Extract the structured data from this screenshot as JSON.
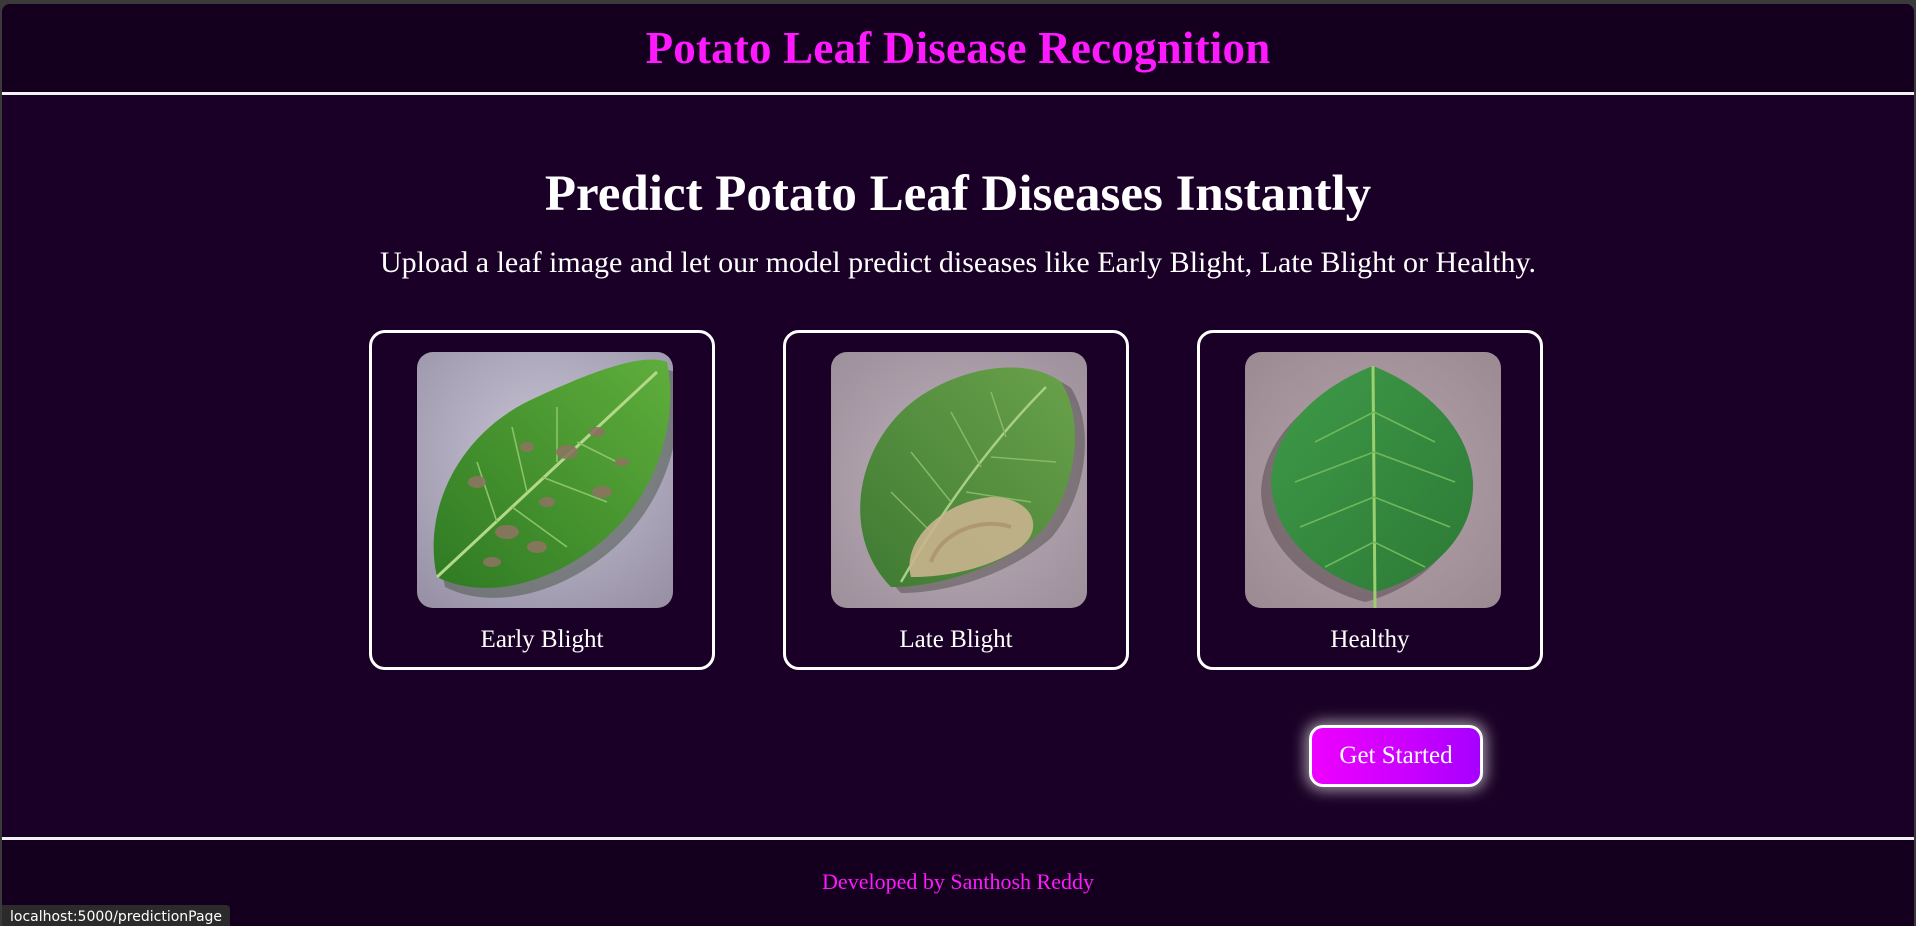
{
  "header": {
    "title": "Potato Leaf Disease Recognition"
  },
  "main": {
    "title": "Predict Potato Leaf Diseases Instantly",
    "subtitle": "Upload a leaf image and let our model predict diseases like Early Blight, Late Blight or Healthy.",
    "cards": [
      {
        "label": "Early Blight",
        "image": "early-blight-leaf-image"
      },
      {
        "label": "Late Blight",
        "image": "late-blight-leaf-image"
      },
      {
        "label": "Healthy",
        "image": "healthy-leaf-image"
      }
    ],
    "cta_label": "Get Started"
  },
  "footer": {
    "credit": "Developed by Santhosh Reddy"
  },
  "status_url": "localhost:5000/predictionPage",
  "colors": {
    "accent": "#ff19ff",
    "background": "#1a0026",
    "header_bg": "#14001e",
    "button_gradient_start": "#ee00ff",
    "button_gradient_end": "#a600ff"
  }
}
